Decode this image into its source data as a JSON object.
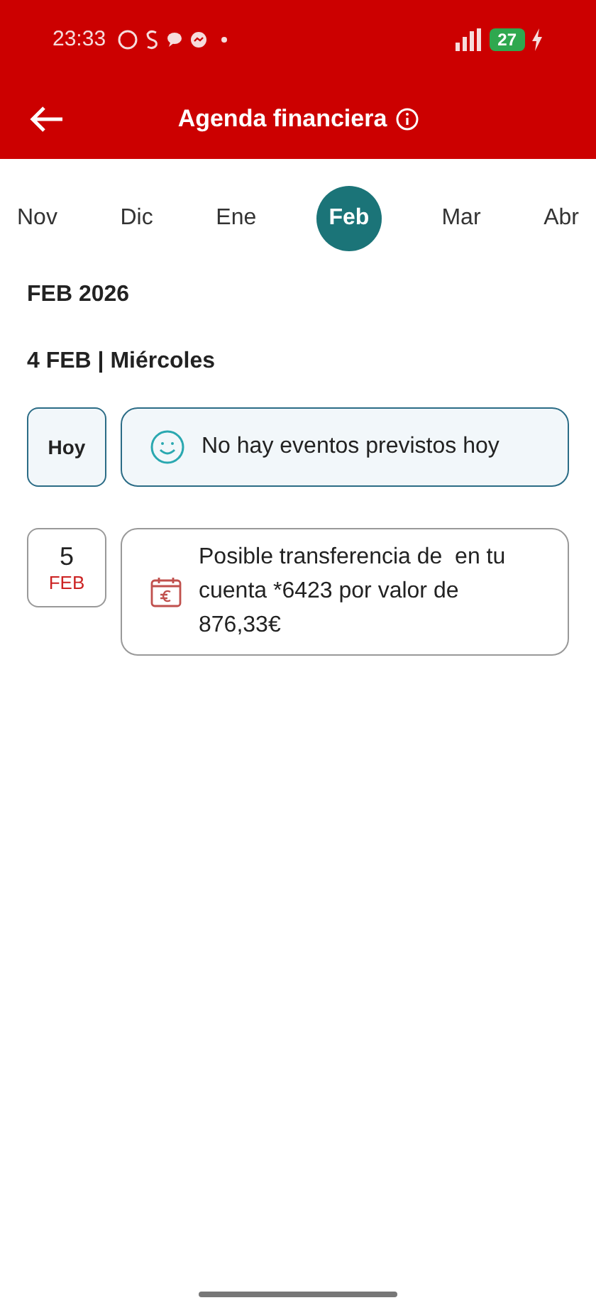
{
  "status_bar": {
    "time": "23:33",
    "battery": "27"
  },
  "header": {
    "title": "Agenda financiera"
  },
  "months": [
    {
      "label": "Nov",
      "selected": false
    },
    {
      "label": "Dic",
      "selected": false
    },
    {
      "label": "Ene",
      "selected": false
    },
    {
      "label": "Feb",
      "selected": true
    },
    {
      "label": "Mar",
      "selected": false
    },
    {
      "label": "Abr",
      "selected": false
    }
  ],
  "month_heading": "FEB 2026",
  "day_heading": "4 FEB | Miércoles",
  "events": [
    {
      "kind": "today",
      "date_label": "Hoy",
      "text": "No hay eventos previstos hoy"
    },
    {
      "kind": "event",
      "day": "5",
      "month": "FEB",
      "text": "Posible transferencia de  en tu cuenta *6423 por valor de 876,33€"
    }
  ]
}
